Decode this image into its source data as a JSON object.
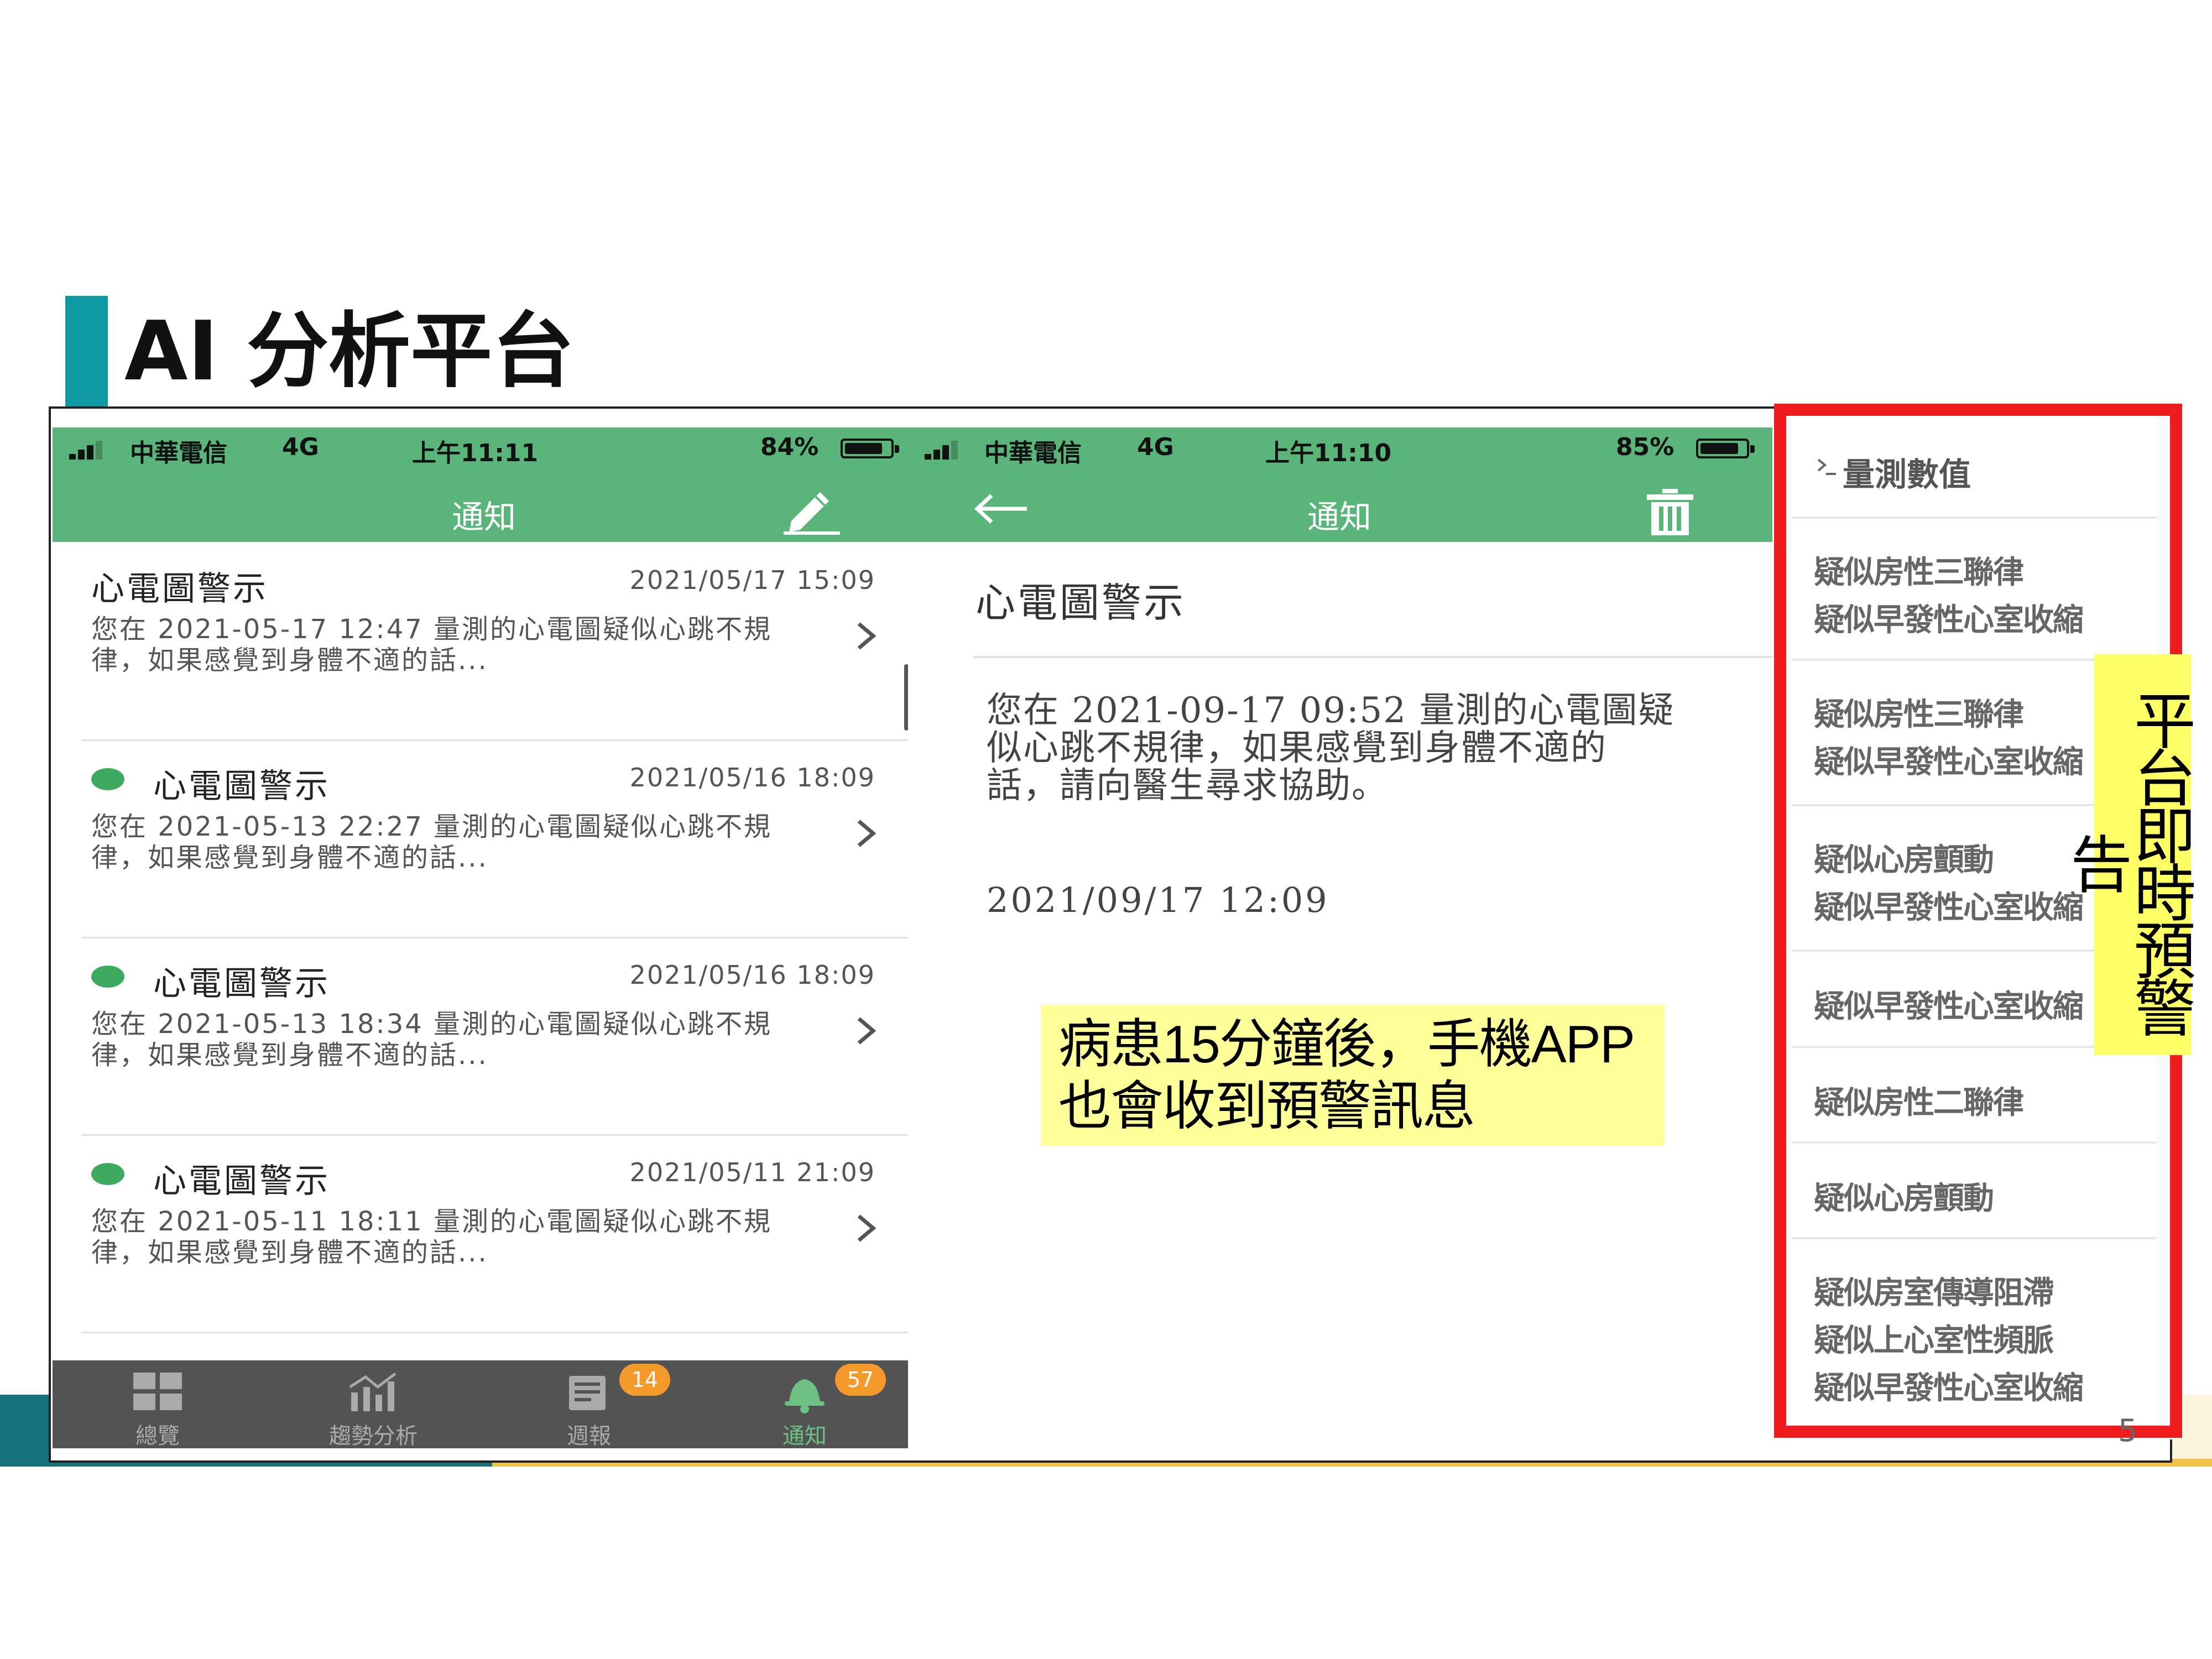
{
  "slide": {
    "title": "AI 分析平台",
    "page_number": "5"
  },
  "list_screen": {
    "status": {
      "carrier": "中華電信",
      "network": "4G",
      "time": "上午11:11",
      "battery": "84%",
      "battery_level": 0.84
    },
    "nav_title": "通知",
    "items": [
      {
        "title": "心電圖警示",
        "timestamp": "2021/05/17 15:09",
        "unread": false,
        "body": "您在 2021-05-17 12:47 量測的心電圖疑似心跳不規律，如果感覺到身體不適的話..."
      },
      {
        "title": "心電圖警示",
        "timestamp": "2021/05/16 18:09",
        "unread": true,
        "body": "您在 2021-05-13 22:27 量測的心電圖疑似心跳不規律，如果感覺到身體不適的話..."
      },
      {
        "title": "心電圖警示",
        "timestamp": "2021/05/16 18:09",
        "unread": true,
        "body": "您在 2021-05-13 18:34 量測的心電圖疑似心跳不規律，如果感覺到身體不適的話..."
      },
      {
        "title": "心電圖警示",
        "timestamp": "2021/05/11 21:09",
        "unread": true,
        "body": "您在 2021-05-11 18:11 量測的心電圖疑似心跳不規律，如果感覺到身體不適的話..."
      }
    ],
    "tabs": [
      {
        "label": "總覽",
        "icon": "dashboard-icon",
        "badge": ""
      },
      {
        "label": "趨勢分析",
        "icon": "trend-chart-icon",
        "badge": ""
      },
      {
        "label": "週報",
        "icon": "report-icon",
        "badge": "14"
      },
      {
        "label": "通知",
        "icon": "bell-icon",
        "badge": "57",
        "active": true
      }
    ]
  },
  "detail_screen": {
    "status": {
      "carrier": "中華電信",
      "network": "4G",
      "time": "上午11:10",
      "battery": "85%",
      "battery_level": 0.85
    },
    "nav_title": "通知",
    "title": "心電圖警示",
    "body": "您在 2021-09-17 09:52 量測的心電圖疑似心跳不規律，如果感覺到身體不適的話，請向醫生尋求協助。",
    "timestamp": "2021/09/17 12:09"
  },
  "callout": {
    "line1": "病患15分鐘後，手機APP",
    "line2": "也會收到預警訊息"
  },
  "alerts_panel": {
    "header": "量測數值",
    "items": [
      [
        "疑似房性三聯律",
        "疑似早發性心室收縮"
      ],
      [
        "疑似房性三聯律",
        "疑似早發性心室收縮"
      ],
      [
        "疑似心房顫動",
        "疑似早發性心室收縮"
      ],
      [
        "疑似早發性心室收縮"
      ],
      [
        "疑似房性二聯律"
      ],
      [
        "疑似心房顫動"
      ],
      [
        "疑似房室傳導阻滯",
        "疑似上心室性頻脈",
        "疑似早發性心室收縮"
      ]
    ]
  },
  "vertical_label": "平台即時預警告",
  "colors": {
    "app_green": "#5ab57b",
    "tab_bar": "#535353",
    "badge_orange": "#f39a2a",
    "alert_red": "#ee1c1c",
    "highlight_yellow": "#ffff99",
    "title_accent": "#0f9aa3"
  }
}
